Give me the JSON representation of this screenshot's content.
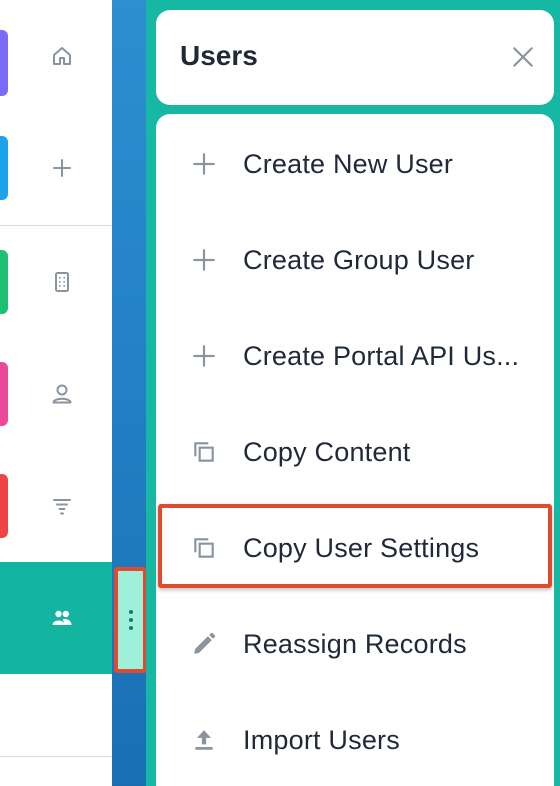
{
  "nav": {
    "items": [
      {
        "id": "home",
        "icon": "home-icon",
        "accent": "#7b6cf6"
      },
      {
        "id": "create",
        "icon": "plus-icon",
        "accent": "#1aa3e8"
      },
      {
        "id": "accounts",
        "icon": "building-icon",
        "accent": "#1dbf73"
      },
      {
        "id": "contacts",
        "icon": "person-icon",
        "accent": "#ec4899"
      },
      {
        "id": "filters",
        "icon": "filter-icon",
        "accent": "#ef4444"
      },
      {
        "id": "users",
        "icon": "users-icon",
        "accent": "#13b5a1",
        "active": true
      }
    ]
  },
  "panel": {
    "title": "Users",
    "close_icon": "close-icon",
    "items": [
      {
        "label": "Create New User",
        "icon": "plus-icon"
      },
      {
        "label": "Create Group User",
        "icon": "plus-icon"
      },
      {
        "label": "Create Portal API Us...",
        "icon": "plus-icon"
      },
      {
        "label": "Copy Content",
        "icon": "copy-icon"
      },
      {
        "label": "Copy User Settings",
        "icon": "copy-icon",
        "highlighted": true
      },
      {
        "label": "Reassign Records",
        "icon": "pencil-icon"
      },
      {
        "label": "Import Users",
        "icon": "upload-icon"
      }
    ]
  },
  "colors": {
    "panel_bg": "#16b8a4",
    "highlight": "#e04a2f",
    "handle_bg": "#9ff0da",
    "icon_gray": "#8a949f"
  }
}
